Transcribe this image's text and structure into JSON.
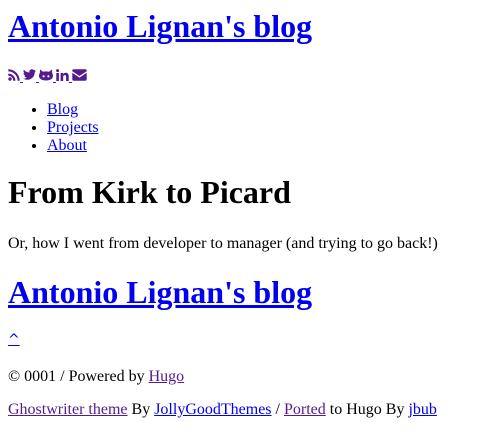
{
  "header": {
    "site_title": "Antonio Lignan's blog"
  },
  "social": {
    "icons": [
      "rss-icon",
      "twitter-icon",
      "github-icon",
      "linkedin-icon",
      "email-icon"
    ],
    "link_color": "#551a8b"
  },
  "nav": {
    "items": [
      {
        "label": "Blog"
      },
      {
        "label": "Projects"
      },
      {
        "label": "About"
      }
    ]
  },
  "post": {
    "title": "From Kirk to Picard",
    "subtitle": "Or, how I went from developer to manager (and trying to go back!)"
  },
  "footer": {
    "site_title": "Antonio Lignan's blog",
    "back_to_top": "^",
    "copyright_prefix": "© 0001 / Powered by ",
    "powered_by_link": "Hugo",
    "theme_link": "Ghostwriter theme",
    "by_text": " By ",
    "jollygood_link": "JollyGoodThemes",
    "sep_text": " / ",
    "ported_link": "Ported",
    "to_hugo_text": " to Hugo By ",
    "jbub_link": "jbub"
  },
  "colors": {
    "link_unvisited": "#0000ee",
    "link_visited": "#551a8b",
    "text": "#000000",
    "background": "#ffffff"
  }
}
